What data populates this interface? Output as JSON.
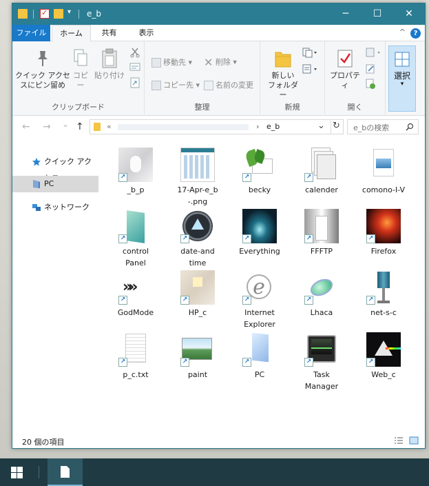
{
  "window": {
    "title": "e_b",
    "controls": {
      "minimize": "─",
      "maximize": "☐",
      "close": "✕"
    },
    "qa_dropdown": "▾",
    "accent": "#2b7d93"
  },
  "ribbon_tabs": [
    {
      "label": "ファイル"
    },
    {
      "label": "ホーム"
    },
    {
      "label": "共有"
    },
    {
      "label": "表示"
    }
  ],
  "ribbon_help": "?",
  "ribbon_collapse": "^",
  "ribbon": {
    "clipboard": {
      "pin": "クイック アクセ\nスにピン留め",
      "copy": "コピー",
      "paste": "貼り付け",
      "label": "クリップボード"
    },
    "organize": {
      "move_to": "移動先",
      "copy_to": "コピー先",
      "delete": "削除",
      "rename": "名前の変更",
      "label": "整理"
    },
    "new": {
      "new_folder": "新しい\nフォルダー",
      "label": "新規"
    },
    "open": {
      "properties": "プロパティ",
      "label": "開く"
    },
    "select": {
      "label": "選択"
    }
  },
  "address": {
    "back": "←",
    "forward": "→",
    "recent": "⌄",
    "up": "↑",
    "chevron": "«",
    "separator": "›",
    "current": "e_b",
    "dropdown": "⌄",
    "refresh": "↻",
    "search_placeholder": "e_bの検索"
  },
  "nav": [
    {
      "label": "クイック アクセス"
    },
    {
      "label": "PC"
    },
    {
      "label": "ネットワーク"
    }
  ],
  "files": [
    {
      "name": "_b_p"
    },
    {
      "name": "17-Apr-e_b\n-.png"
    },
    {
      "name": "becky"
    },
    {
      "name": "calender"
    },
    {
      "name": "comono-I-V"
    },
    {
      "name": "control\nPanel"
    },
    {
      "name": "date-and\ntime"
    },
    {
      "name": "Everything"
    },
    {
      "name": "FFFTP"
    },
    {
      "name": "Firefox"
    },
    {
      "name": "GodMode"
    },
    {
      "name": "HP_c"
    },
    {
      "name": "Internet\nExplorer"
    },
    {
      "name": "Lhaca"
    },
    {
      "name": "net-s-c"
    },
    {
      "name": "p_c.txt"
    },
    {
      "name": "paint"
    },
    {
      "name": "PC"
    },
    {
      "name": "Task\nManager"
    },
    {
      "name": "Web_c"
    }
  ],
  "status": {
    "item_count": "20 個の項目"
  }
}
